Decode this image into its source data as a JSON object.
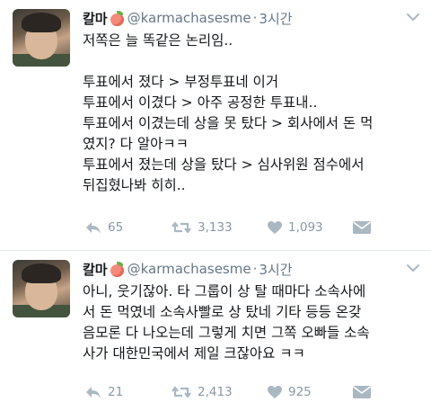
{
  "tweets": [
    {
      "display_name": "칼마",
      "handle": "@karmachasesme",
      "dot": "·",
      "time": "3시간",
      "lines": [
        "저쪽은 늘 똑같은 논리임..",
        "",
        "투표에서 졌다 > 부정투표네 이거",
        "투표에서 이겼다 > 아주 공정한 투표내..",
        "투표에서 이겼는데 상을 못 탔다 > 회사에서 돈 먹",
        "였지? 다 알아ㅋㅋ",
        "투표에서 졌는데 상을 탔다 > 심사위원 점수에서",
        "뒤집혔나봐 히히.."
      ],
      "replies": "65",
      "retweets": "3,133",
      "likes": "1,093"
    },
    {
      "display_name": "칼마",
      "handle": "@karmachasesme",
      "dot": "·",
      "time": "3시간",
      "lines": [
        "아니, 웃기잖아. 타 그룹이 상 탈 때마다 소속사에",
        "서 돈 먹였네 소속사빨로 상 탔네 기타 등등 온갖",
        "음모론 다 나오는데 그렇게 치면 그쪽 오빠들 소속",
        "사가 대한민국에서 제일 크잖아요 ㅋㅋ"
      ],
      "replies": "21",
      "retweets": "2,413",
      "likes": "925"
    }
  ],
  "icons": {
    "reply": "reply-icon",
    "retweet": "retweet-icon",
    "like": "heart-icon",
    "dm": "envelope-icon",
    "more": "chevron-down-icon",
    "badge": "peach-icon"
  },
  "colors": {
    "text": "#14171a",
    "muted": "#657786",
    "action": "#8899a6",
    "divider": "#e1e8ed"
  }
}
